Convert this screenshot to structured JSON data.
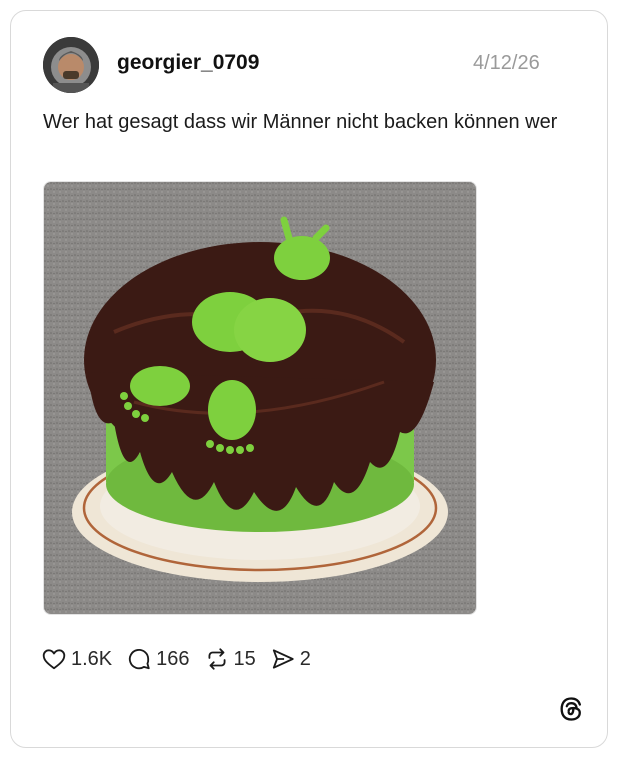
{
  "post": {
    "username": "georgier_0709",
    "timestamp": "4/12/26",
    "text": "Wer hat gesagt dass wir Männer nicht backen können wer",
    "image_description_icon": "cake-photo"
  },
  "actions": {
    "likes": "1.6K",
    "comments": "166",
    "reposts": "15",
    "shares": "2"
  },
  "icons": {
    "like": "heart-icon",
    "comment": "comment-bubble-icon",
    "repost": "repost-icon",
    "share": "send-icon",
    "brand": "threads-logo-icon"
  },
  "colors": {
    "border": "#d9d9d9",
    "muted_text": "#9a9a9a",
    "text": "#1a1a1a"
  }
}
